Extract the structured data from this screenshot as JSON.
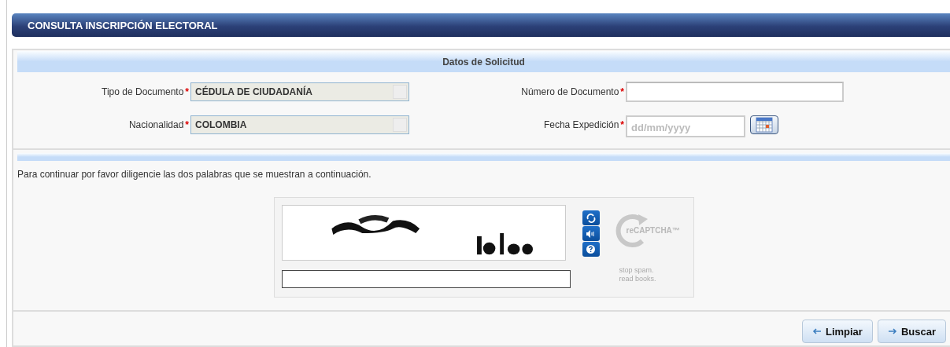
{
  "header": {
    "title": "CONSULTA INSCRIPCIÓN ELECTORAL"
  },
  "section": {
    "title": "Datos de Solicitud"
  },
  "fields": [
    {
      "kind": "select",
      "label": "Tipo de Documento",
      "required_mark": "*",
      "value": "CÉDULA DE CIUDADANÍA"
    },
    {
      "kind": "text",
      "label": "Número de Documento",
      "required_mark": "*"
    },
    {
      "kind": "select",
      "label": "Nacionalidad",
      "required_mark": "*",
      "value": "COLOMBIA"
    },
    {
      "kind": "date",
      "label": "Fecha Expedición",
      "required_mark": "*",
      "placeholder": "dd/mm/yyyy"
    }
  ],
  "instructions": "Para continuar por favor diligencie las dos palabras que se muestran a continuación.",
  "captcha": {
    "logo": "reCAPTCHA™",
    "tagline": [
      "stop spam.",
      "read books."
    ]
  },
  "buttons": [
    {
      "kind": "back",
      "label": "Limpiar"
    },
    {
      "kind": "forward",
      "label": "Buscar"
    }
  ]
}
